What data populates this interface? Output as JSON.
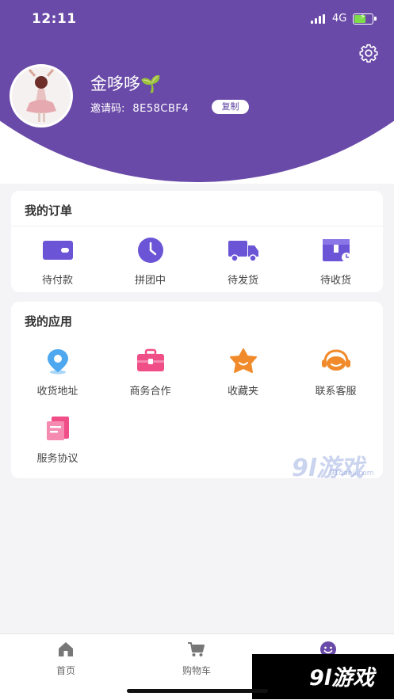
{
  "status_bar": {
    "time": "12:11",
    "network": "4G"
  },
  "profile": {
    "username": "金哆哆🌱",
    "invite_label": "邀请码:",
    "invite_code": "8E58CBF4",
    "copy_label": "复制"
  },
  "orders": {
    "title": "我的订单",
    "items": [
      {
        "label": "待付款",
        "icon": "wallet-icon"
      },
      {
        "label": "拼团中",
        "icon": "clock-icon"
      },
      {
        "label": "待发货",
        "icon": "truck-icon"
      },
      {
        "label": "待收货",
        "icon": "package-icon"
      }
    ]
  },
  "apps": {
    "title": "我的应用",
    "items": [
      {
        "label": "收货地址",
        "icon": "location-pin-icon"
      },
      {
        "label": "商务合作",
        "icon": "briefcase-icon"
      },
      {
        "label": "收藏夹",
        "icon": "star-icon"
      },
      {
        "label": "联系客服",
        "icon": "headset-icon"
      },
      {
        "label": "服务协议",
        "icon": "agreement-icon"
      }
    ]
  },
  "tabbar": {
    "items": [
      {
        "label": "首页",
        "icon": "home-icon"
      },
      {
        "label": "购物车",
        "icon": "cart-icon"
      },
      {
        "label": "",
        "icon": "profile-icon"
      }
    ]
  },
  "watermark": {
    "text": "9l游戏",
    "sub": "91danji.com"
  },
  "colors": {
    "brand": "#6a4aa8",
    "icon_purple": "#6b55d6",
    "pink": "#f04e86",
    "orange": "#f08a2a",
    "blue": "#4ea8f0"
  }
}
